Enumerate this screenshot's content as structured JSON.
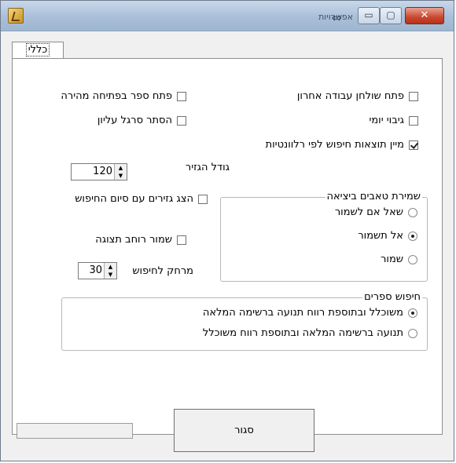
{
  "window": {
    "title": "אפשרויות",
    "controls": {
      "minimize": "▭",
      "maximize": "▢",
      "close": "✕"
    }
  },
  "tabs": [
    {
      "label": "כללי"
    }
  ],
  "options": {
    "open_last_desk": "פתח שולחן עבודה אחרון",
    "open_quick_book": "פתח ספר בפתיחה מהירה",
    "daily_backup": "גיבוי יומי",
    "hide_top_bar": "הסתר סרגל עליון",
    "sort_by_relevance": "מיין תוצאות חיפוש לפי רלוונטיות",
    "clip_size_label": "גודל הגזיר",
    "clip_size_value": "120",
    "show_clips": "הצג גזירים עם סיום החיפוש",
    "save_display_width": "שמור רוחב תצוגה",
    "search_distance_label": "מרחק לחיפוש",
    "search_distance_value": "30"
  },
  "save_tabs_group": {
    "title": "שמירת טאבים ביציאה",
    "items": [
      "שאל אם לשמור",
      "אל תשמור",
      "שמור"
    ],
    "selected_index": 1
  },
  "book_search_group": {
    "title": "חיפוש ספרים",
    "items": [
      "משוכלל ובתוספת רווח תנועה ברשימה המלאה",
      "תנועה ברשימה המלאה ובתוספת רווח משוכלל"
    ],
    "selected_index": 0
  },
  "footer": {
    "close_label": "סגור"
  },
  "colors": {
    "title_bar": "#a9bfd8",
    "close_button": "#c9472e",
    "panel": "#ffffff"
  }
}
